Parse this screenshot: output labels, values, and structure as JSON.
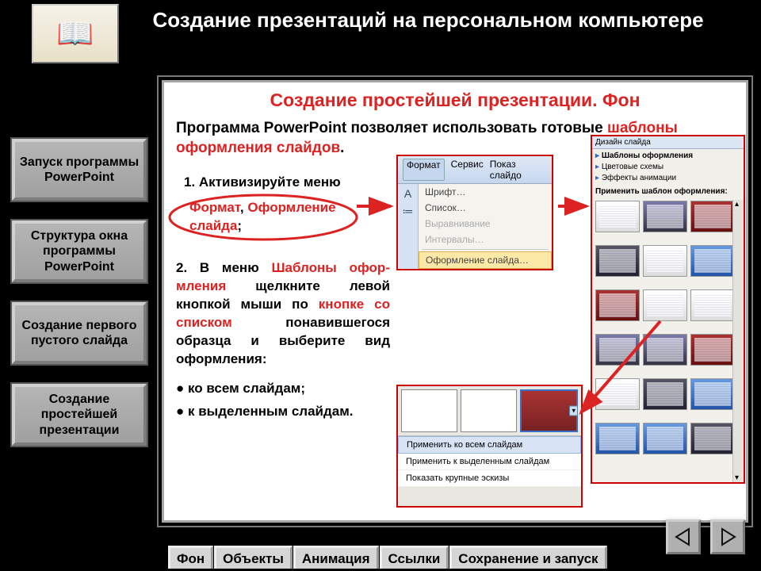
{
  "header": "Создание презентаций на персональном компьютере",
  "slide_title": "Создание простейшей презентации. Фон",
  "intro": {
    "plain1": "Программа PowerPoint позволяет использовать готовые ",
    "hl": "шаблоны оформления слайдов",
    "plain2": "."
  },
  "step1_label": "1.   Активизируйте меню",
  "oval": {
    "p1": "Формат",
    "comma": ", ",
    "p2": "Оформление слайда",
    "p3": ";"
  },
  "step2": {
    "t1": "2. В меню ",
    "h1": "Шаблоны офор­мления",
    "t2": " щелкните левой кнопкой мыши по ",
    "h2": "кнопке со списком",
    "t3": " понавившегося образца и выберите вид оформления:"
  },
  "bullets": {
    "b1": "● ко всем слайдам;",
    "b2": "● к выделенным слайдам."
  },
  "nav": {
    "n1": "Запуск программы PowerPoint",
    "n2": "Структура окна программы PowerPoint",
    "n3": "Создание первого пустого слайда",
    "n4": "Создание простейшей презентации"
  },
  "tabs": {
    "t1": "Фон",
    "t2": "Объекты",
    "t3": "Анимация",
    "t4": "Ссылки",
    "t5": "Сохранение и запуск"
  },
  "menu": {
    "bar": {
      "m1": "Формат",
      "m2": "Сервис",
      "m3": "Показ слайдо"
    },
    "i1": "Шрифт…",
    "i2": "Список…",
    "i3": "Выравнивание",
    "i4": "Интервалы…",
    "i5": "Оформление слайда…"
  },
  "pane": {
    "head": "Дизайн слайда",
    "opt1": "Шаблоны оформления",
    "opt2": "Цветовые схемы",
    "opt3": "Эффекты анимации",
    "caption": "Применить шаблон оформления:"
  },
  "popup": {
    "m1": "Применить ко всем слайдам",
    "m2": "Применить к выделенным слайдам",
    "m3": "Показать крупные эскизы"
  }
}
